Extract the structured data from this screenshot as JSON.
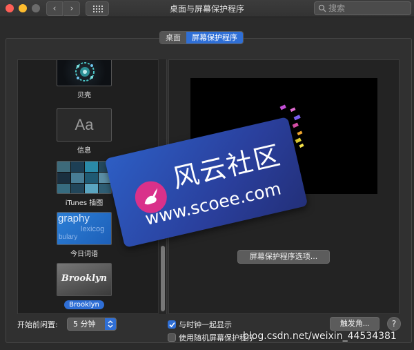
{
  "window": {
    "title": "桌面与屏幕保护程序",
    "search_placeholder": "搜索"
  },
  "tabs": [
    {
      "label": "桌面",
      "active": false
    },
    {
      "label": "屏幕保护程序",
      "active": true
    }
  ],
  "screensavers": [
    {
      "label": "贝壳",
      "selected": false
    },
    {
      "label": "信息",
      "selected": false,
      "thumb_text": "Aa"
    },
    {
      "label": "iTunes 插图",
      "selected": false
    },
    {
      "label": "今日词语",
      "selected": false,
      "thumb_text": "graphy",
      "thumb_text2": "lexicog",
      "thumb_text3": "bulary"
    },
    {
      "label": "Brooklyn",
      "selected": true,
      "thumb_text": "Brooklyn"
    }
  ],
  "preview": {
    "options_button": "屏幕保护程序选项..."
  },
  "bottom": {
    "idle_label": "开始前闲置:",
    "idle_value": "5 分钟",
    "show_clock_label": "与时钟一起显示",
    "show_clock_checked": true,
    "random_label": "使用随机屏幕保护程序",
    "random_checked": false,
    "hot_corners_button": "触发角...",
    "help_label": "?"
  },
  "watermark": {
    "title": "风云社区",
    "url": "www.scoee.com",
    "csdn": "blog.csdn.net/weixin_44534381"
  },
  "colors": {
    "accent": "#2f6fd6",
    "close": "#fe5f57",
    "minimize": "#febc2e"
  }
}
